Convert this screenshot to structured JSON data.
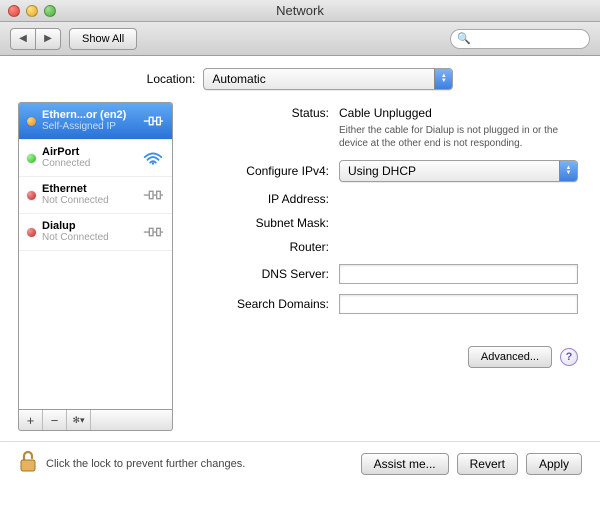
{
  "window": {
    "title": "Network"
  },
  "toolbar": {
    "show_all": "Show All",
    "search_placeholder": ""
  },
  "location": {
    "label": "Location:",
    "selected": "Automatic"
  },
  "sidebar": {
    "items": [
      {
        "name": "Ethern...or (en2)",
        "sub": "Self-Assigned IP",
        "dot": "orange",
        "icon": "ethernet",
        "selected": true
      },
      {
        "name": "AirPort",
        "sub": "Connected",
        "dot": "green",
        "icon": "wifi",
        "selected": false
      },
      {
        "name": "Ethernet",
        "sub": "Not Connected",
        "dot": "red",
        "icon": "ethernet",
        "selected": false
      },
      {
        "name": "Dialup",
        "sub": "Not Connected",
        "dot": "red",
        "icon": "ethernet",
        "selected": false
      }
    ],
    "buttons": {
      "add": "+",
      "remove": "−",
      "action": "✻▾"
    }
  },
  "detail": {
    "status_label": "Status:",
    "status_value": "Cable Unplugged",
    "status_msg": "Either the cable for Dialup is not plugged in or the device at the other end is not responding.",
    "configure_label": "Configure IPv4:",
    "configure_value": "Using DHCP",
    "ip_label": "IP Address:",
    "ip_value": "",
    "subnet_label": "Subnet Mask:",
    "subnet_value": "",
    "router_label": "Router:",
    "router_value": "",
    "dns_label": "DNS Server:",
    "dns_value": "",
    "search_label": "Search Domains:",
    "search_value": "",
    "advanced": "Advanced...",
    "help": "?"
  },
  "bottom": {
    "lock_text": "Click the lock to prevent further changes.",
    "assist": "Assist me...",
    "revert": "Revert",
    "apply": "Apply"
  }
}
